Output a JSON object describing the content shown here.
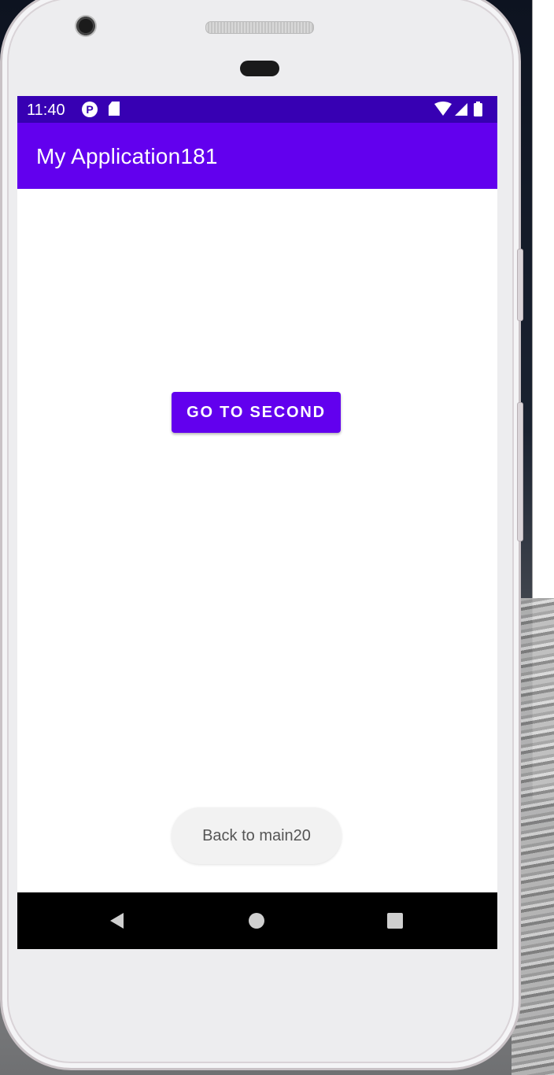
{
  "status_bar": {
    "time": "11:40",
    "icons": [
      "pocket-icon",
      "sd-card-icon",
      "wifi-icon",
      "signal-icon",
      "battery-icon"
    ],
    "color": "#3700b3"
  },
  "app_bar": {
    "title": "My Application181",
    "color": "#6200ee"
  },
  "main": {
    "button_label": "GO TO SECOND"
  },
  "toast": {
    "message": "Back to main20"
  },
  "nav_bar": {
    "buttons": [
      "back-icon",
      "home-icon",
      "recents-icon"
    ]
  }
}
